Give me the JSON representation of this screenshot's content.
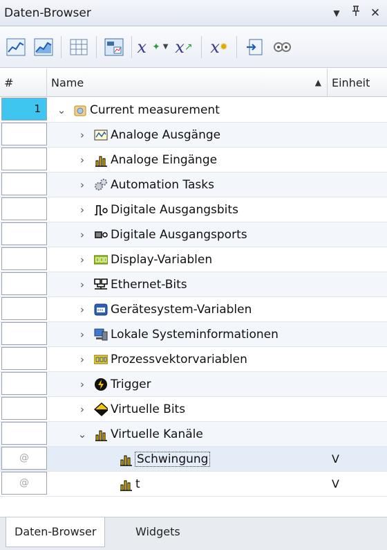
{
  "window": {
    "title": "Daten-Browser",
    "dropdown_glyph": "▼",
    "pin_glyph": "📌",
    "close_glyph": "✕"
  },
  "toolbar": {
    "formula_symbol": "x",
    "dropdown_arrow": "▼",
    "icons": [
      "chart-icon",
      "chart-add-icon",
      "table-icon",
      "display-icon",
      "formula-new-icon",
      "formula-edit-icon",
      "formula-variable-icon",
      "import-icon",
      "view-icon"
    ]
  },
  "columns": {
    "num": "#",
    "name": "Name",
    "unit": "Einheit",
    "sort_glyph": "▲"
  },
  "tree": {
    "root": {
      "num": "1",
      "chevron": "⌄",
      "label": "Current measurement"
    },
    "expand_glyph": "›",
    "collapse_glyph": "⌄",
    "groups": [
      {
        "label": "Analoge Ausgänge",
        "icon": "analog-output-icon"
      },
      {
        "label": "Analoge Eingänge",
        "icon": "analog-input-icon"
      },
      {
        "label": "Automation Tasks",
        "icon": "gears-icon"
      },
      {
        "label": "Digitale Ausgangsbits",
        "icon": "digital-bit-icon"
      },
      {
        "label": "Digitale Ausgangsports",
        "icon": "digital-port-icon"
      },
      {
        "label": "Display-Variablen",
        "icon": "display-variable-icon"
      },
      {
        "label": "Ethernet-Bits",
        "icon": "ethernet-icon"
      },
      {
        "label": "Gerätesystem-Variablen",
        "icon": "device-system-icon"
      },
      {
        "label": "Lokale Systeminformationen",
        "icon": "computer-icon"
      },
      {
        "label": "Prozessvektorvariablen",
        "icon": "process-vector-icon"
      },
      {
        "label": "Trigger",
        "icon": "trigger-icon"
      },
      {
        "label": "Virtuelle Bits",
        "icon": "virtual-bits-icon"
      },
      {
        "label": "Virtuelle Kanäle",
        "icon": "virtual-channel-icon"
      }
    ],
    "channels": [
      {
        "num": "@",
        "label": "Schwingung",
        "unit": "V"
      },
      {
        "num": "@",
        "label": "t",
        "unit": "V"
      }
    ]
  },
  "tabs": [
    {
      "label": "Daten-Browser"
    },
    {
      "label": "Widgets"
    }
  ],
  "colors": {
    "active_num": "#3ec6f0",
    "selected_row": "#e4ecf7"
  }
}
